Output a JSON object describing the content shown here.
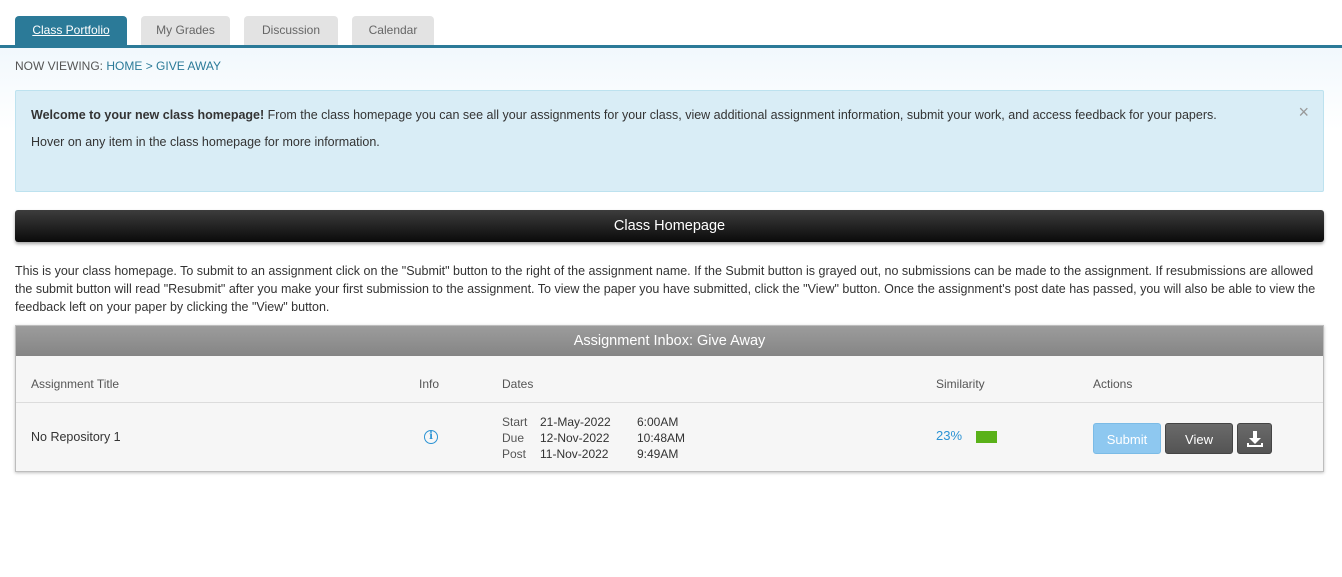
{
  "tabs": [
    {
      "label": "Class Portfolio",
      "active": true
    },
    {
      "label": "My Grades",
      "active": false
    },
    {
      "label": "Discussion",
      "active": false
    },
    {
      "label": "Calendar",
      "active": false
    }
  ],
  "breadcrumb": {
    "prefix": "NOW VIEWING:",
    "home": "HOME",
    "separator": ">",
    "current": "GIVE AWAY"
  },
  "welcome": {
    "bold": "Welcome to your new class homepage!",
    "text": " From the class homepage you can see all your assignments for your class, view additional assignment information, submit your work, and access feedback for your papers.",
    "hint": "Hover on any item in the class homepage for more information.",
    "close_glyph": "×"
  },
  "homepage_header": "Class Homepage",
  "intro_text": "This is your class homepage. To submit to an assignment click on the \"Submit\" button to the right of the assignment name. If the Submit button is grayed out, no submissions can be made to the assignment. If resubmissions are allowed the submit button will read \"Resubmit\" after you make your first submission to the assignment. To view the paper you have submitted, click the \"View\" button. Once the assignment's post date has passed, you will also be able to view the feedback left on your paper by clicking the \"View\" button.",
  "inbox": {
    "title": "Assignment Inbox: Give Away",
    "columns": {
      "title": "Assignment Title",
      "info": "Info",
      "dates": "Dates",
      "similarity": "Similarity",
      "actions": "Actions"
    },
    "row": {
      "title": "No Repository 1",
      "info_icon": "info-circle-icon",
      "dates": [
        {
          "label": "Start",
          "date": "21-May-2022",
          "time": "6:00AM"
        },
        {
          "label": "Due",
          "date": "12-Nov-2022",
          "time": "10:48AM"
        },
        {
          "label": "Post",
          "date": "11-Nov-2022",
          "time": "9:49AM"
        }
      ],
      "similarity": "23%",
      "similarity_color": "#5ab119",
      "submit_label": "Submit",
      "view_label": "View",
      "download_icon": "download-icon"
    }
  },
  "colors": {
    "accent": "#2b7a98",
    "alert_bg": "#d9edf6",
    "link": "#2c93d4"
  }
}
